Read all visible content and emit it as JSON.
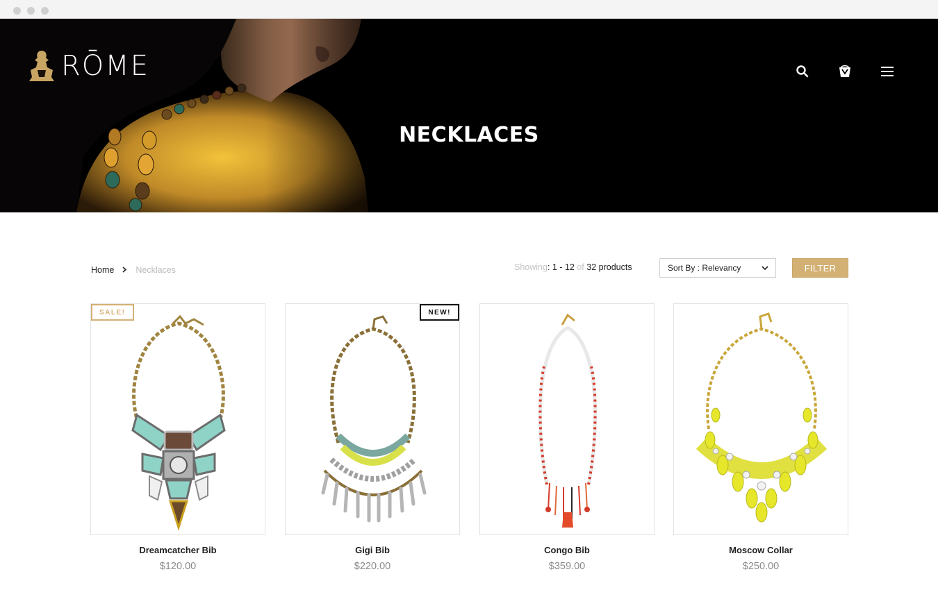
{
  "brand": {
    "name": "RŌME"
  },
  "header": {
    "title": "NECKLACES",
    "icons": [
      "search-icon",
      "shopping-bag-icon",
      "hamburger-menu-icon"
    ]
  },
  "breadcrumb": {
    "home": "Home",
    "current": "Necklaces"
  },
  "listing": {
    "showing_label": "Showing",
    "showing_range": "1 - 12",
    "of_label": "of",
    "total": "32 products",
    "sort_label": "Sort By : Relevancy",
    "filter_label": "FILTER"
  },
  "colors": {
    "accent": "#d3b175",
    "badge_new": "#111111",
    "price": "#8a8a8a"
  },
  "products": [
    {
      "name": "Dreamcatcher Bib",
      "price": "$120.00",
      "badge": "SALE!"
    },
    {
      "name": "Gigi Bib",
      "price": "$220.00",
      "badge": "NEW!"
    },
    {
      "name": "Congo Bib",
      "price": "$359.00",
      "badge": ""
    },
    {
      "name": "Moscow Collar",
      "price": "$250.00",
      "badge": ""
    }
  ]
}
